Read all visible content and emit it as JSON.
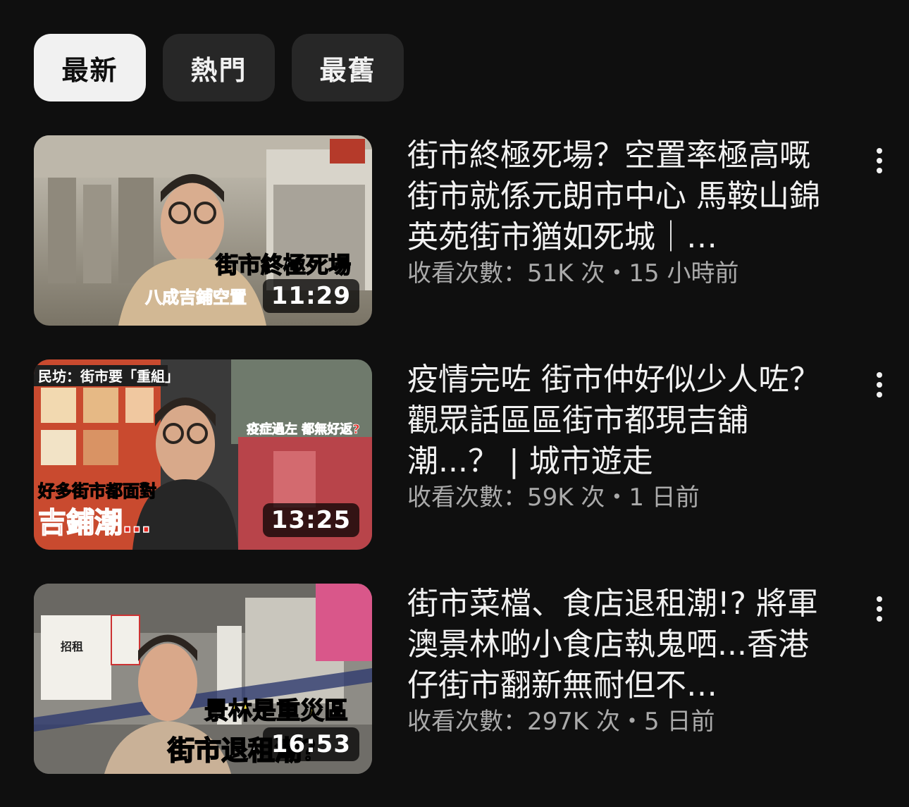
{
  "filters": {
    "chips": [
      {
        "label": "最新",
        "active": true
      },
      {
        "label": "熱門",
        "active": false
      },
      {
        "label": "最舊",
        "active": false
      }
    ]
  },
  "videos": [
    {
      "title": "街市終極死場？空置率極高嘅街市就係元朗市中心 馬鞍山錦英苑街市猶如死城｜…",
      "meta": "收看次數：51K 次・15 小時前",
      "duration": "11:29",
      "thumb_text": [
        "街市終極死場",
        "八成吉鋪空置"
      ]
    },
    {
      "title": "疫情完咗 街市仲好似少人咗？觀眾話區區街市都現吉舖潮...？ | 城市遊走",
      "meta": "收看次數：59K 次・1 日前",
      "duration": "13:25",
      "thumb_text": [
        "民坊：街市要「重組」",
        "好多街市都面對",
        "吉鋪潮…",
        "疫症過左 都無好返?"
      ]
    },
    {
      "title": "街市菜檔、食店退租潮!? 將軍澳景林啲小食店執鬼哂...香港仔街市翻新無耐但不…",
      "meta": "收看次數：297K 次・5 日前",
      "duration": "16:53",
      "thumb_text": [
        "景林是重災區",
        "街市退租潮？",
        "招租"
      ]
    }
  ]
}
